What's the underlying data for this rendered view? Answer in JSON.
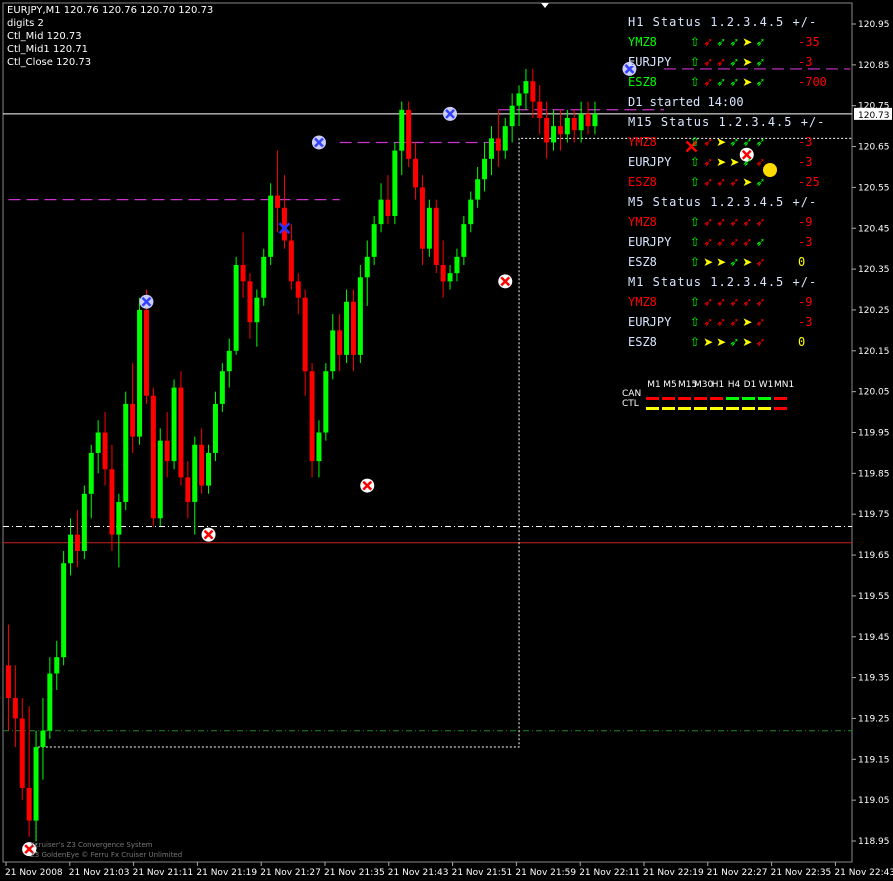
{
  "header": {
    "symbol_line": "EURJPY,M1  120.76 120.76 120.70 120.73",
    "digits": "digits 2",
    "ctl_mid": "Ctl_Mid 120.73",
    "ctl_mid1": "Ctl_Mid1 120.71",
    "ctl_close": "Ctl_Close 120.73"
  },
  "price_label": "120.73",
  "colors": {
    "bull": "#00ff00",
    "bear": "#ff0000",
    "background": "#000000",
    "magenta": "#cc33cc",
    "grid_white": "#ffffff"
  },
  "panel": {
    "h1": {
      "title": "H1 Status 1.2.3.4.5  +/-",
      "rows": [
        {
          "sym": "YMZ8",
          "color": "#00ff00",
          "arrows": [
            [
              "⇧",
              "#00ff00"
            ],
            [
              "➶",
              "#ff0000"
            ],
            [
              "➶",
              "#00ff00"
            ],
            [
              "➶",
              "#00ff00"
            ],
            [
              "➤",
              "#ffff00"
            ],
            [
              "➶",
              "#00ff00"
            ]
          ],
          "val": "-35",
          "vcolor": "#ff0000"
        },
        {
          "sym": "EURJPY",
          "color": "#d8e6ff",
          "arrows": [
            [
              "⇧",
              "#00ff00"
            ],
            [
              "➶",
              "#ff0000"
            ],
            [
              "➶",
              "#ff0000"
            ],
            [
              "➶",
              "#00ff00"
            ],
            [
              "➤",
              "#ffff00"
            ],
            [
              "➶",
              "#00ff00"
            ]
          ],
          "val": "-3",
          "vcolor": "#ff0000"
        },
        {
          "sym": "ESZ8",
          "color": "#00ff00",
          "arrows": [
            [
              "⇧",
              "#00ff00"
            ],
            [
              "➶",
              "#ff0000"
            ],
            [
              "➶",
              "#00ff00"
            ],
            [
              "➶",
              "#00ff00"
            ],
            [
              "➤",
              "#ffff00"
            ],
            [
              "➶",
              "#00ff00"
            ]
          ],
          "val": "-700",
          "vcolor": "#ff0000"
        }
      ]
    },
    "info": "D1 started 14:00",
    "m15": {
      "title": "M15 Status 1.2.3.4.5  +/-",
      "rows": [
        {
          "sym": "YMZ8",
          "color": "#ff0000",
          "arrows": [
            [
              "⇧",
              "#00ff00"
            ],
            [
              "➶",
              "#ff0000"
            ],
            [
              "➤",
              "#ffff00"
            ],
            [
              "➶",
              "#00ff00"
            ],
            [
              "➶",
              "#00ff00"
            ],
            [
              "➶",
              "#00ff00"
            ]
          ],
          "val": "-3",
          "vcolor": "#ff0000"
        },
        {
          "sym": "EURJPY",
          "color": "#d8e6ff",
          "arrows": [
            [
              "⇧",
              "#00ff00"
            ],
            [
              "➶",
              "#ff0000"
            ],
            [
              "➤",
              "#ffff00"
            ],
            [
              "➤",
              "#ffff00"
            ],
            [
              "➶",
              "#00ff00"
            ],
            [
              "➶",
              "#ff0000"
            ]
          ],
          "val": "-3",
          "vcolor": "#ff0000"
        },
        {
          "sym": "ESZ8",
          "color": "#ff0000",
          "arrows": [
            [
              "⇧",
              "#00ff00"
            ],
            [
              "➶",
              "#ff0000"
            ],
            [
              "➶",
              "#ff0000"
            ],
            [
              "➶",
              "#ff0000"
            ],
            [
              "➤",
              "#ffff00"
            ],
            [
              "➶",
              "#00ff00"
            ]
          ],
          "val": "-25",
          "vcolor": "#ff0000"
        }
      ]
    },
    "m5": {
      "title": "M5 Status 1.2.3.4.5  +/-",
      "rows": [
        {
          "sym": "YMZ8",
          "color": "#ff0000",
          "arrows": [
            [
              "⇧",
              "#00ff00"
            ],
            [
              "➶",
              "#ff0000"
            ],
            [
              "➶",
              "#ff0000"
            ],
            [
              "➶",
              "#ff0000"
            ],
            [
              "➶",
              "#ff0000"
            ],
            [
              "➶",
              "#ff0000"
            ]
          ],
          "val": "-9",
          "vcolor": "#ff0000"
        },
        {
          "sym": "EURJPY",
          "color": "#d8e6ff",
          "arrows": [
            [
              "⇧",
              "#00ff00"
            ],
            [
              "➶",
              "#ff0000"
            ],
            [
              "➶",
              "#ff0000"
            ],
            [
              "➶",
              "#ff0000"
            ],
            [
              "➶",
              "#ff0000"
            ],
            [
              "➶",
              "#00ff00"
            ]
          ],
          "val": "-3",
          "vcolor": "#ff0000"
        },
        {
          "sym": "ESZ8",
          "color": "#d8e6ff",
          "arrows": [
            [
              "⇧",
              "#00ff00"
            ],
            [
              "➤",
              "#ffff00"
            ],
            [
              "➤",
              "#ffff00"
            ],
            [
              "➶",
              "#00ff00"
            ],
            [
              "➤",
              "#ffff00"
            ],
            [
              "➶",
              "#ff0000"
            ]
          ],
          "val": "0",
          "vcolor": "#ffff00"
        }
      ]
    },
    "m1": {
      "title": "M1 Status 1.2.3.4.5  +/-",
      "rows": [
        {
          "sym": "YMZ8",
          "color": "#ff0000",
          "arrows": [
            [
              "⇧",
              "#00ff00"
            ],
            [
              "➶",
              "#ff0000"
            ],
            [
              "➶",
              "#ff0000"
            ],
            [
              "➶",
              "#ff0000"
            ],
            [
              "➶",
              "#ff0000"
            ],
            [
              "➶",
              "#ff0000"
            ]
          ],
          "val": "-9",
          "vcolor": "#ff0000"
        },
        {
          "sym": "EURJPY",
          "color": "#d8e6ff",
          "arrows": [
            [
              "⇧",
              "#00ff00"
            ],
            [
              "➶",
              "#ff0000"
            ],
            [
              "➶",
              "#ff0000"
            ],
            [
              "➶",
              "#ff0000"
            ],
            [
              "➤",
              "#ffff00"
            ],
            [
              "➶",
              "#ff0000"
            ]
          ],
          "val": "-3",
          "vcolor": "#ff0000"
        },
        {
          "sym": "ESZ8",
          "color": "#d8e6ff",
          "arrows": [
            [
              "⇧",
              "#00ff00"
            ],
            [
              "➤",
              "#ffff00"
            ],
            [
              "➤",
              "#ffff00"
            ],
            [
              "➶",
              "#00ff00"
            ],
            [
              "➤",
              "#ffff00"
            ],
            [
              "➶",
              "#ff0000"
            ]
          ],
          "val": "0",
          "vcolor": "#ffff00"
        }
      ]
    }
  },
  "mtf": {
    "timeframes": [
      "M1",
      "M5",
      "M15",
      "M30",
      "H1",
      "H4",
      "D1",
      "W1",
      "MN1"
    ],
    "can_label": "CAN",
    "ctl_label": "CTL",
    "can_colors": [
      "#ff0000",
      "#ff0000",
      "#ff0000",
      "#ff0000",
      "#ff0000",
      "#00ff00",
      "#00ff00",
      "#00ff00",
      "#ff0000"
    ],
    "ctl_colors": [
      "#ffff00",
      "#ffff00",
      "#ffff00",
      "#ffff00",
      "#ffff00",
      "#ffff00",
      "#ffff00",
      "#ffff00",
      "#ff0000"
    ]
  },
  "footer": {
    "line1": "Xcruiser's Z3 Convergence System",
    "line2": "Z3 GoldenEye © Ferru Fx Cruiser Unlimited"
  },
  "chart_data": {
    "type": "candlestick",
    "symbol": "EURJPY",
    "timeframe": "M1",
    "ylim": [
      118.85,
      121.0
    ],
    "y_ticks": [
      "120.95",
      "120.85",
      "120.75",
      "120.65",
      "120.55",
      "120.45",
      "120.35",
      "120.25",
      "120.15",
      "120.05",
      "119.95",
      "119.85",
      "119.75",
      "119.65",
      "119.55",
      "119.45",
      "119.35",
      "119.25",
      "119.15",
      "119.05",
      "118.95"
    ],
    "x_ticks": [
      "21 Nov 2008",
      "21 Nov 21:03",
      "21 Nov 21:11",
      "21 Nov 21:19",
      "21 Nov 21:27",
      "21 Nov 21:35",
      "21 Nov 21:43",
      "21 Nov 21:51",
      "21 Nov 21:59",
      "21 Nov 22:11",
      "21 Nov 22:19",
      "21 Nov 22:27",
      "21 Nov 22:35",
      "21 Nov 22:43"
    ],
    "last_price": 120.73,
    "horizontal_lines": [
      {
        "price": 120.73,
        "style": "solid",
        "color": "#ffffff"
      },
      {
        "price": 119.72,
        "style": "dashdot",
        "color": "#ffffff"
      },
      {
        "price": 119.68,
        "style": "solid",
        "color": "#cc2222"
      },
      {
        "price": 119.22,
        "style": "dashdot",
        "color": "#228822"
      }
    ],
    "candles": [
      {
        "o": 119.38,
        "h": 119.48,
        "l": 119.22,
        "c": 119.3
      },
      {
        "o": 119.3,
        "h": 119.38,
        "l": 119.18,
        "c": 119.25
      },
      {
        "o": 119.25,
        "h": 119.3,
        "l": 119.05,
        "c": 119.08
      },
      {
        "o": 119.08,
        "h": 119.28,
        "l": 118.96,
        "c": 119.0
      },
      {
        "o": 119.0,
        "h": 119.22,
        "l": 118.95,
        "c": 119.18
      },
      {
        "o": 119.18,
        "h": 119.3,
        "l": 119.1,
        "c": 119.22
      },
      {
        "o": 119.22,
        "h": 119.4,
        "l": 119.2,
        "c": 119.36
      },
      {
        "o": 119.36,
        "h": 119.44,
        "l": 119.32,
        "c": 119.4
      },
      {
        "o": 119.4,
        "h": 119.66,
        "l": 119.38,
        "c": 119.63
      },
      {
        "o": 119.63,
        "h": 119.74,
        "l": 119.6,
        "c": 119.7
      },
      {
        "o": 119.7,
        "h": 119.76,
        "l": 119.62,
        "c": 119.66
      },
      {
        "o": 119.66,
        "h": 119.82,
        "l": 119.64,
        "c": 119.8
      },
      {
        "o": 119.8,
        "h": 119.92,
        "l": 119.74,
        "c": 119.9
      },
      {
        "o": 119.9,
        "h": 119.98,
        "l": 119.85,
        "c": 119.95
      },
      {
        "o": 119.95,
        "h": 120.0,
        "l": 119.82,
        "c": 119.86
      },
      {
        "o": 119.86,
        "h": 119.92,
        "l": 119.66,
        "c": 119.7
      },
      {
        "o": 119.7,
        "h": 119.8,
        "l": 119.62,
        "c": 119.78
      },
      {
        "o": 119.78,
        "h": 120.05,
        "l": 119.76,
        "c": 120.02
      },
      {
        "o": 120.02,
        "h": 120.12,
        "l": 119.9,
        "c": 119.94
      },
      {
        "o": 119.94,
        "h": 120.28,
        "l": 119.92,
        "c": 120.25
      },
      {
        "o": 120.25,
        "h": 120.3,
        "l": 120.02,
        "c": 120.04
      },
      {
        "o": 120.04,
        "h": 120.06,
        "l": 119.72,
        "c": 119.74
      },
      {
        "o": 119.74,
        "h": 119.96,
        "l": 119.72,
        "c": 119.93
      },
      {
        "o": 119.93,
        "h": 120.0,
        "l": 119.84,
        "c": 119.88
      },
      {
        "o": 119.88,
        "h": 120.08,
        "l": 119.86,
        "c": 120.06
      },
      {
        "o": 120.06,
        "h": 120.1,
        "l": 119.82,
        "c": 119.84
      },
      {
        "o": 119.84,
        "h": 119.88,
        "l": 119.74,
        "c": 119.78
      },
      {
        "o": 119.78,
        "h": 119.94,
        "l": 119.7,
        "c": 119.92
      },
      {
        "o": 119.92,
        "h": 119.96,
        "l": 119.8,
        "c": 119.82
      },
      {
        "o": 119.82,
        "h": 119.92,
        "l": 119.8,
        "c": 119.9
      },
      {
        "o": 119.9,
        "h": 120.05,
        "l": 119.88,
        "c": 120.02
      },
      {
        "o": 120.02,
        "h": 120.12,
        "l": 120.0,
        "c": 120.1
      },
      {
        "o": 120.1,
        "h": 120.18,
        "l": 120.06,
        "c": 120.15
      },
      {
        "o": 120.15,
        "h": 120.38,
        "l": 120.14,
        "c": 120.36
      },
      {
        "o": 120.36,
        "h": 120.44,
        "l": 120.28,
        "c": 120.32
      },
      {
        "o": 120.32,
        "h": 120.34,
        "l": 120.18,
        "c": 120.22
      },
      {
        "o": 120.22,
        "h": 120.3,
        "l": 120.16,
        "c": 120.28
      },
      {
        "o": 120.28,
        "h": 120.4,
        "l": 120.26,
        "c": 120.38
      },
      {
        "o": 120.38,
        "h": 120.56,
        "l": 120.36,
        "c": 120.53
      },
      {
        "o": 120.53,
        "h": 120.64,
        "l": 120.44,
        "c": 120.5
      },
      {
        "o": 120.5,
        "h": 120.58,
        "l": 120.4,
        "c": 120.42
      },
      {
        "o": 120.42,
        "h": 120.46,
        "l": 120.3,
        "c": 120.32
      },
      {
        "o": 120.32,
        "h": 120.34,
        "l": 120.24,
        "c": 120.28
      },
      {
        "o": 120.28,
        "h": 120.3,
        "l": 120.04,
        "c": 120.1
      },
      {
        "o": 120.1,
        "h": 120.12,
        "l": 119.84,
        "c": 119.88
      },
      {
        "o": 119.88,
        "h": 119.98,
        "l": 119.84,
        "c": 119.95
      },
      {
        "o": 119.95,
        "h": 120.12,
        "l": 119.93,
        "c": 120.1
      },
      {
        "o": 120.1,
        "h": 120.24,
        "l": 120.08,
        "c": 120.2
      },
      {
        "o": 120.2,
        "h": 120.24,
        "l": 120.1,
        "c": 120.14
      },
      {
        "o": 120.14,
        "h": 120.3,
        "l": 120.12,
        "c": 120.27
      },
      {
        "o": 120.27,
        "h": 120.3,
        "l": 120.1,
        "c": 120.14
      },
      {
        "o": 120.14,
        "h": 120.36,
        "l": 120.12,
        "c": 120.33
      },
      {
        "o": 120.33,
        "h": 120.42,
        "l": 120.26,
        "c": 120.38
      },
      {
        "o": 120.38,
        "h": 120.48,
        "l": 120.36,
        "c": 120.46
      },
      {
        "o": 120.46,
        "h": 120.56,
        "l": 120.44,
        "c": 120.52
      },
      {
        "o": 120.52,
        "h": 120.58,
        "l": 120.46,
        "c": 120.48
      },
      {
        "o": 120.48,
        "h": 120.66,
        "l": 120.46,
        "c": 120.64
      },
      {
        "o": 120.64,
        "h": 120.76,
        "l": 120.58,
        "c": 120.74
      },
      {
        "o": 120.74,
        "h": 120.76,
        "l": 120.6,
        "c": 120.62
      },
      {
        "o": 120.62,
        "h": 120.66,
        "l": 120.52,
        "c": 120.55
      },
      {
        "o": 120.55,
        "h": 120.58,
        "l": 120.36,
        "c": 120.4
      },
      {
        "o": 120.4,
        "h": 120.52,
        "l": 120.38,
        "c": 120.5
      },
      {
        "o": 120.5,
        "h": 120.52,
        "l": 120.34,
        "c": 120.36
      },
      {
        "o": 120.36,
        "h": 120.42,
        "l": 120.28,
        "c": 120.32
      },
      {
        "o": 120.32,
        "h": 120.36,
        "l": 120.3,
        "c": 120.34
      },
      {
        "o": 120.34,
        "h": 120.4,
        "l": 120.32,
        "c": 120.38
      },
      {
        "o": 120.38,
        "h": 120.48,
        "l": 120.36,
        "c": 120.46
      },
      {
        "o": 120.46,
        "h": 120.54,
        "l": 120.44,
        "c": 120.52
      },
      {
        "o": 120.52,
        "h": 120.6,
        "l": 120.5,
        "c": 120.57
      },
      {
        "o": 120.57,
        "h": 120.66,
        "l": 120.54,
        "c": 120.62
      },
      {
        "o": 120.62,
        "h": 120.7,
        "l": 120.58,
        "c": 120.67
      },
      {
        "o": 120.67,
        "h": 120.74,
        "l": 120.6,
        "c": 120.64
      },
      {
        "o": 120.64,
        "h": 120.72,
        "l": 120.62,
        "c": 120.7
      },
      {
        "o": 120.7,
        "h": 120.78,
        "l": 120.66,
        "c": 120.75
      },
      {
        "o": 120.75,
        "h": 120.8,
        "l": 120.7,
        "c": 120.78
      },
      {
        "o": 120.78,
        "h": 120.84,
        "l": 120.74,
        "c": 120.81
      },
      {
        "o": 120.81,
        "h": 120.84,
        "l": 120.72,
        "c": 120.76
      },
      {
        "o": 120.76,
        "h": 120.8,
        "l": 120.68,
        "c": 120.72
      },
      {
        "o": 120.72,
        "h": 120.76,
        "l": 120.62,
        "c": 120.66
      },
      {
        "o": 120.66,
        "h": 120.74,
        "l": 120.64,
        "c": 120.7
      },
      {
        "o": 120.7,
        "h": 120.74,
        "l": 120.64,
        "c": 120.68
      },
      {
        "o": 120.68,
        "h": 120.74,
        "l": 120.66,
        "c": 120.72
      },
      {
        "o": 120.72,
        "h": 120.74,
        "l": 120.66,
        "c": 120.69
      },
      {
        "o": 120.69,
        "h": 120.76,
        "l": 120.66,
        "c": 120.73
      },
      {
        "o": 120.73,
        "h": 120.76,
        "l": 120.68,
        "c": 120.7
      },
      {
        "o": 120.7,
        "h": 120.76,
        "l": 120.68,
        "c": 120.73
      }
    ],
    "markers": [
      {
        "i": 3,
        "price": 118.93,
        "kind": "sell-circle"
      },
      {
        "i": 20,
        "price": 120.27,
        "kind": "buy-circle"
      },
      {
        "i": 29,
        "price": 119.7,
        "kind": "sell-circle"
      },
      {
        "i": 40,
        "price": 120.45,
        "kind": "cross-blue"
      },
      {
        "i": 45,
        "price": 120.66,
        "kind": "buy-circle"
      },
      {
        "i": 52,
        "price": 119.82,
        "kind": "sell-circle"
      },
      {
        "i": 64,
        "price": 120.73,
        "kind": "buy-circle"
      },
      {
        "i": 72,
        "price": 120.32,
        "kind": "sell-circle"
      },
      {
        "i": 90,
        "price": 120.84,
        "kind": "buy-circle"
      },
      {
        "i": 99,
        "price": 120.65,
        "kind": "cross-red"
      },
      {
        "i": 107,
        "price": 120.63,
        "kind": "sell-circle"
      }
    ]
  }
}
